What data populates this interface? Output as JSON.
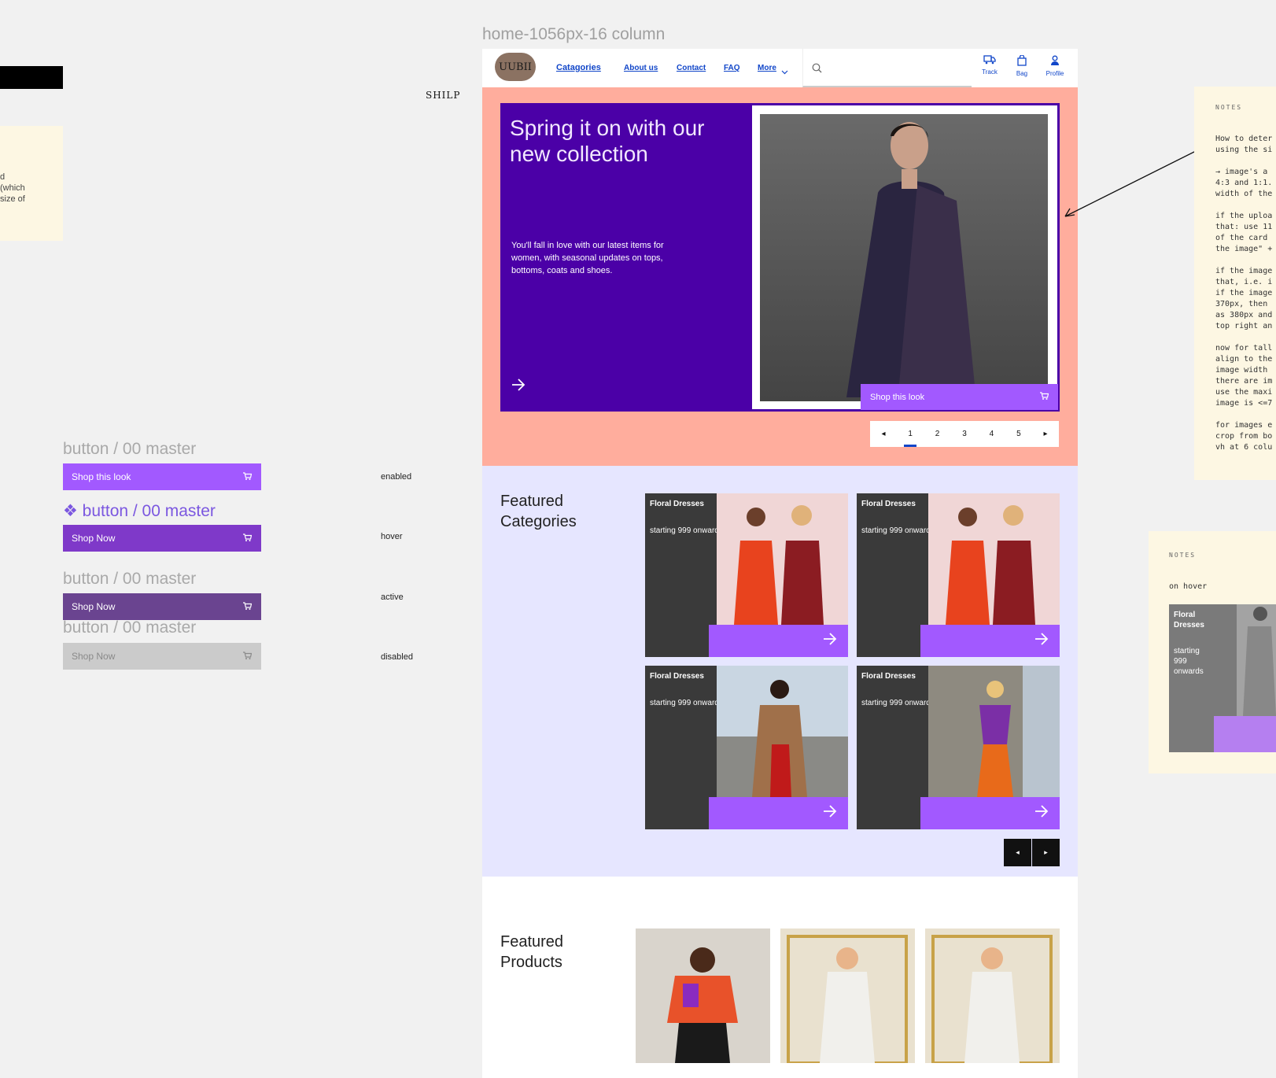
{
  "frame_title": "home-1056px-16 column",
  "brand_tag": "SHILP",
  "left_note": {
    "lines": [
      "d",
      "(which",
      "size of"
    ]
  },
  "components": {
    "title": "button / 00 master",
    "title_component": "❖ button / 00 master",
    "buttons": [
      {
        "state": "enabled",
        "label": "Shop this look"
      },
      {
        "state": "hover",
        "label": "Shop Now"
      },
      {
        "state": "active",
        "label": "Shop Now"
      },
      {
        "state": "disabled",
        "label": "Shop Now"
      }
    ]
  },
  "nav": {
    "logo": "UUBII",
    "links": [
      "Catagories",
      "About us",
      "Contact",
      "FAQ",
      "More"
    ],
    "search_placeholder": "",
    "actions": [
      "Track",
      "Bag",
      "Profile"
    ]
  },
  "hero": {
    "title": "Spring it on with our new collection",
    "body": "You'll fall in love with our latest items for women, with seasonal updates on tops, bottoms, coats and shoes.",
    "cta": "Shop this look",
    "pages": [
      "1",
      "2",
      "3",
      "4",
      "5"
    ],
    "active_page": "1"
  },
  "featured_categories": {
    "title": "Featured Categories",
    "cards": [
      {
        "name": "Floral Dresses",
        "sub": "starting 999 onwards"
      },
      {
        "name": "Floral Dresses",
        "sub": "starting 999 onwards"
      },
      {
        "name": "Floral Dresses",
        "sub": "starting 999 onwards"
      },
      {
        "name": "Floral Dresses",
        "sub": "starting 999 onwards"
      }
    ]
  },
  "featured_products": {
    "title": "Featured Products"
  },
  "notes": {
    "n1_head": "NOTES",
    "n1_body": "How to deter\nusing the si\n\n→ image's a\n4:3 and 1:1.\nwidth of the\n\nif the uploa\nthat: use 11\nof the card\nthe image\" +\n\nif the image\nthat, i.e. i\nif the image\n370px, then\nas 380px and\ntop right an\n\nnow for tall\nalign to the\nimage width\nthere are im\nuse the maxi\nimage is <=7\n\nfor images e\ncrop from bo\nvh at 6 colu",
    "n2_head": "NOTES",
    "n2_body": "on hover",
    "n2_card_name": "Floral Dresses",
    "n2_card_sub": "starting 999 onwards"
  },
  "colors": {
    "accent": "#a259ff",
    "hero_bg": "#ffad9d",
    "hero_card": "#4b00a7",
    "link": "#1146c9",
    "featured_bg": "#e6e6ff"
  }
}
